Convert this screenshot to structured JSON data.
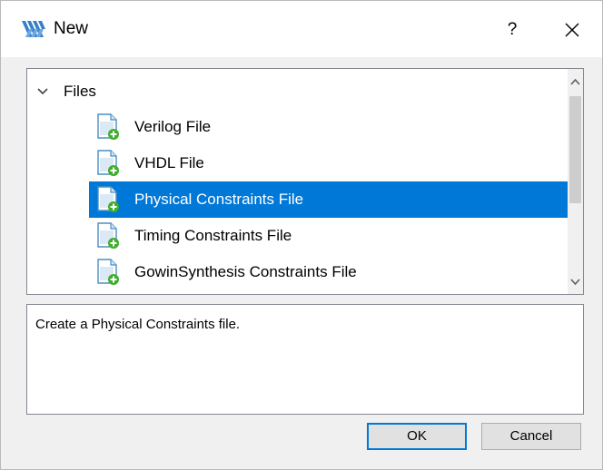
{
  "window": {
    "title": "New",
    "help_label": "?",
    "app_icon": "gowin-logo-icon",
    "close_icon": "close-icon"
  },
  "tree": {
    "root_label": "Files",
    "items": [
      {
        "label": "Verilog File",
        "selected": false
      },
      {
        "label": "VHDL File",
        "selected": false
      },
      {
        "label": "Physical Constraints File",
        "selected": true
      },
      {
        "label": "Timing Constraints File",
        "selected": false
      },
      {
        "label": "GowinSynthesis Constraints File",
        "selected": false
      }
    ]
  },
  "description": {
    "text": "Create a Physical Constraints file."
  },
  "buttons": {
    "ok_label": "OK",
    "cancel_label": "Cancel"
  },
  "colors": {
    "selection": "#0078d7",
    "icon_green": "#3fae2a",
    "icon_blue": "#4a8fc4",
    "logo_blue": "#3a7fc8"
  }
}
